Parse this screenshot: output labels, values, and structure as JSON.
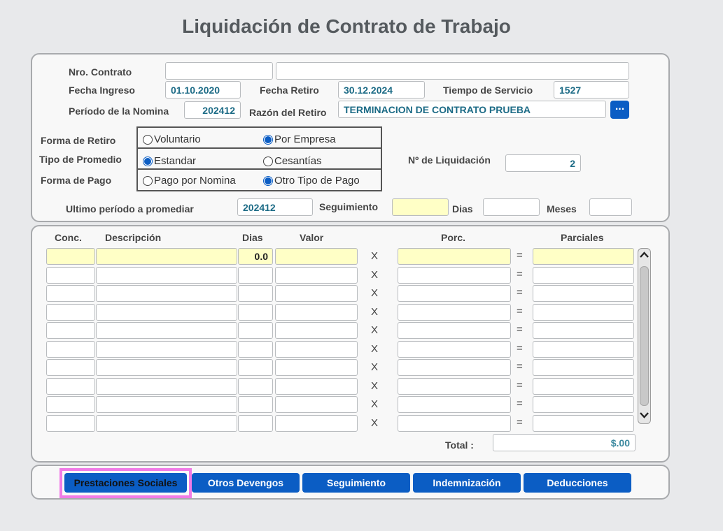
{
  "title": "Liquidación de Contrato de Trabajo",
  "header": {
    "nro_contrato_label": "Nro. Contrato",
    "nro_contrato_value": "",
    "nro_contrato_desc": "",
    "fecha_ingreso_label": "Fecha Ingreso",
    "fecha_ingreso_value": "01.10.2020",
    "fecha_retiro_label": "Fecha  Retiro",
    "fecha_retiro_value": "30.12.2024",
    "tiempo_servicio_label": "Tiempo de Servicio",
    "tiempo_servicio_value": "1527",
    "periodo_nomina_label": "Período de la Nomina",
    "periodo_nomina_value": "202412",
    "razon_retiro_label": "Razón del Retiro",
    "razon_retiro_value": "TERMINACION DE CONTRATO PRUEBA",
    "lookup_label": "...",
    "forma_retiro_label": "Forma de Retiro",
    "forma_retiro_options": [
      "Voluntario",
      "Por Empresa"
    ],
    "forma_retiro_selected": "Por Empresa",
    "tipo_promedio_label": "Tipo de Promedio",
    "tipo_promedio_options": [
      "Estandar",
      "Cesantías"
    ],
    "tipo_promedio_selected": "Estandar",
    "forma_pago_label": "Forma de Pago",
    "forma_pago_options": [
      "Pago por Nomina",
      "Otro Tipo de Pago"
    ],
    "forma_pago_selected": "Otro Tipo de Pago",
    "nro_liquidacion_label": "Nº de Liquidación",
    "nro_liquidacion_value": "2",
    "ultimo_periodo_label": "Ultimo período a promediar",
    "ultimo_periodo_value": "202412",
    "seguimiento_label": "Seguimiento",
    "seguimiento_value": "",
    "dias_label": "Dias",
    "dias_value": "",
    "meses_label": "Meses",
    "meses_value": ""
  },
  "grid": {
    "columns": [
      "Conc.",
      "Descripción",
      "Dias",
      "Valor",
      "Porc.",
      "Parciales"
    ],
    "multiply_symbol": "X",
    "equals_symbol": "=",
    "first_row_dias": "0.0",
    "row_count": 10,
    "total_label": "Total :",
    "total_value": "$.00"
  },
  "tabs": [
    "Prestaciones Sociales",
    "Otros Devengos",
    "Seguimiento",
    "Indemnización",
    "Deducciones"
  ],
  "active_tab": "Prestaciones Sociales",
  "colors": {
    "accent": "#0b5dc4",
    "highlight": "#f07be6",
    "field_text": "#1c6b86",
    "yellow_field": "#ffffc6"
  },
  "icons": {
    "scroll_up": "chevron-up-icon",
    "scroll_down": "chevron-down-icon"
  }
}
